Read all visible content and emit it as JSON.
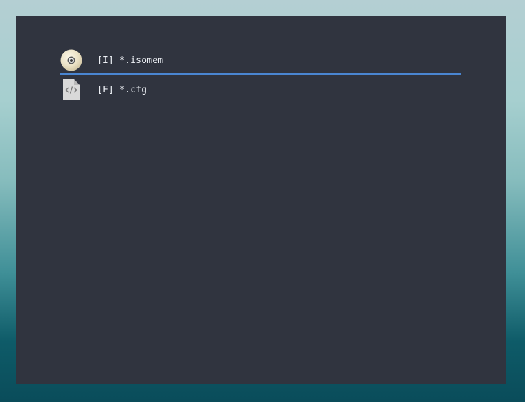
{
  "launcher": {
    "entries": [
      {
        "label": "[I] *.isomem",
        "icon": "disc-icon",
        "selected": true
      },
      {
        "label": "[F] *.cfg",
        "icon": "code-file-icon",
        "selected": false
      }
    ]
  },
  "colors": {
    "window_bg": "#30343f",
    "selection_underline": "#4a86d2",
    "text": "#eceff4"
  }
}
